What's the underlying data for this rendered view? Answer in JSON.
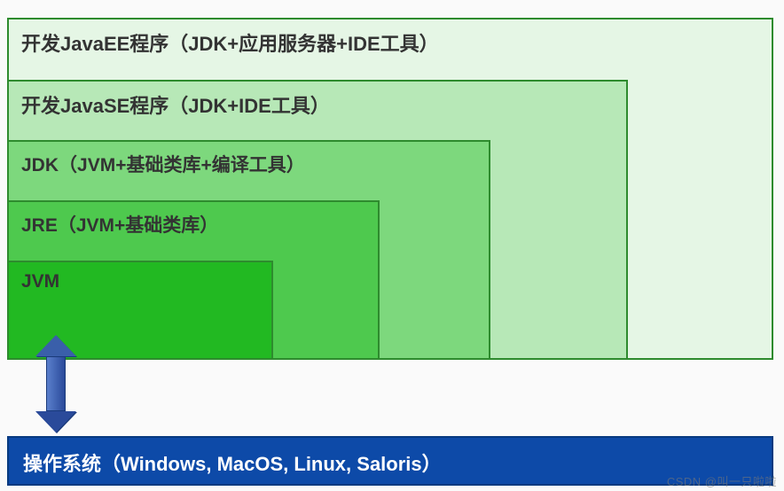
{
  "layers": {
    "javaee": "开发JavaEE程序（JDK+应用服务器+IDE工具）",
    "javase": "开发JavaSE程序（JDK+IDE工具）",
    "jdk": "JDK（JVM+基础类库+编译工具）",
    "jre": "JRE（JVM+基础类库）",
    "jvm": "JVM"
  },
  "os": "操作系统（Windows, MacOS, Linux, Saloris）",
  "watermark": "CSDN @叫一只啦啦"
}
